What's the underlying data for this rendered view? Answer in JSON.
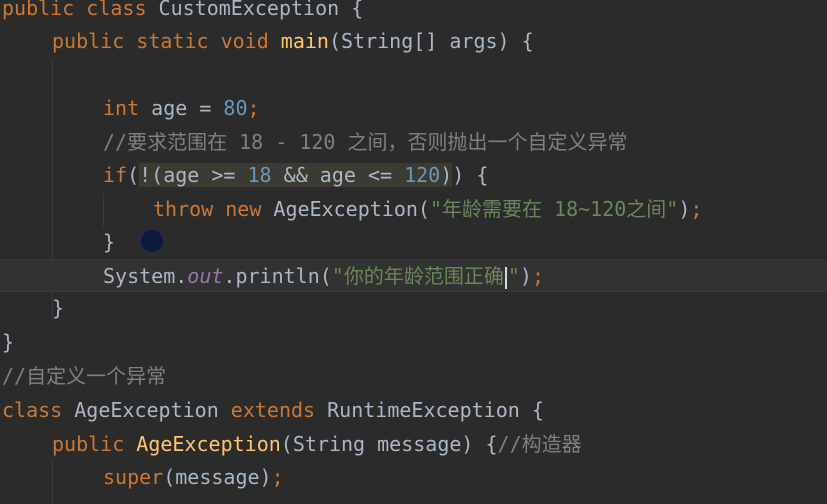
{
  "code": {
    "l1": {
      "k1": "public class ",
      "t1": "CustomException {"
    },
    "l2": {
      "k1": "public static void ",
      "f1": "main",
      "t1": "(String[] args) {"
    },
    "l4": {
      "k1": "int ",
      "t1": "age = ",
      "n1": "80",
      "k2": ";"
    },
    "l5": {
      "c1": "//要求范围在 18 - 120 之间，否则抛出一个自定义异常"
    },
    "l6": {
      "k1": "if",
      "t1": "(",
      "s1": "!(age >= ",
      "n1": "18",
      "s2": " && age <= ",
      "n2": "120",
      "s3": ")",
      "t2": ") {"
    },
    "l7": {
      "k1": "throw new ",
      "t1": "AgeException(",
      "str1": "\"年龄需要在 18~120之间\"",
      "t2": ")",
      "k2": ";"
    },
    "l8": {
      "t1": "}"
    },
    "l9": {
      "t1": "System.",
      "fld": "out",
      "t2": ".println(",
      "str1": "\"你的年龄范围正确",
      "str2": "\"",
      "t3": ")",
      "k1": ";"
    },
    "l10": {
      "t1": "}"
    },
    "l11": {
      "t1": "}"
    },
    "l12": {
      "c1": "//自定义一个异常"
    },
    "l13": {
      "k1": "class ",
      "t1": "AgeException ",
      "k2": "extends ",
      "t2": "RuntimeException {"
    },
    "l14": {
      "k1": "public ",
      "f1": "AgeException",
      "t1": "(String message) {",
      "c1": "//构造器"
    },
    "l15": {
      "k1": "super",
      "t1": "(message)",
      "k2": ";"
    }
  }
}
